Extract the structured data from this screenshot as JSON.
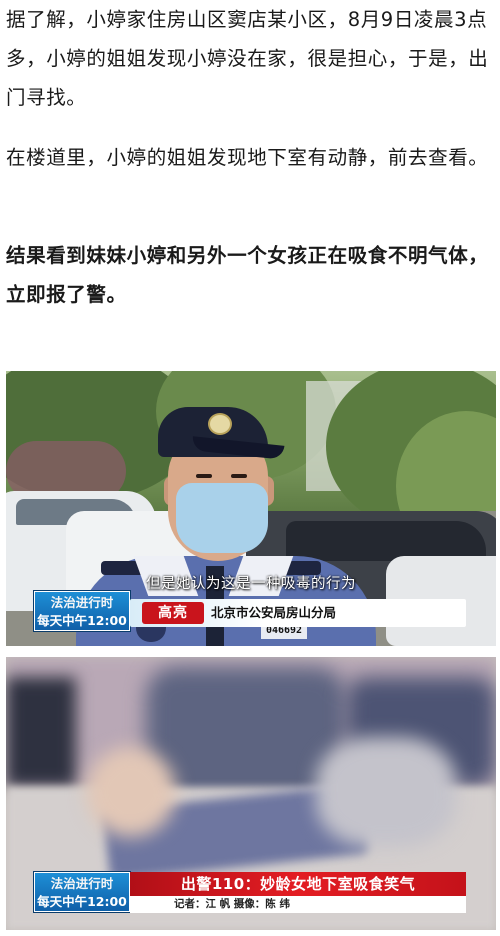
{
  "article": {
    "paragraph1": "据了解，小婷家住房山区窦店某小区，8月9日凌晨3点多，小婷的姐姐发现小婷没在家，很是担心，于是，出门寻找。",
    "paragraph2": "在楼道里，小婷的姐姐发现地下室有动静，前去查看。",
    "paragraph3": "结果看到妹妹小婷和另外一个女孩正在吸食不明气体，立即报了警。"
  },
  "frame1": {
    "subtitle": "但是她认为这是一种吸毒的行为",
    "show_logo_line1": "法治进行时",
    "show_logo_line2": "每天中午12:00",
    "speaker_name": "高亮",
    "speaker_org": "北京市公安局房山分局",
    "officer_badge_number": "046692"
  },
  "frame2": {
    "show_logo_line1": "法治进行时",
    "show_logo_line2": "每天中午12:00",
    "headline": "出警110：妙龄女地下室吸食笑气",
    "credit": "记者：江 帆    摄像：陈 纬"
  }
}
